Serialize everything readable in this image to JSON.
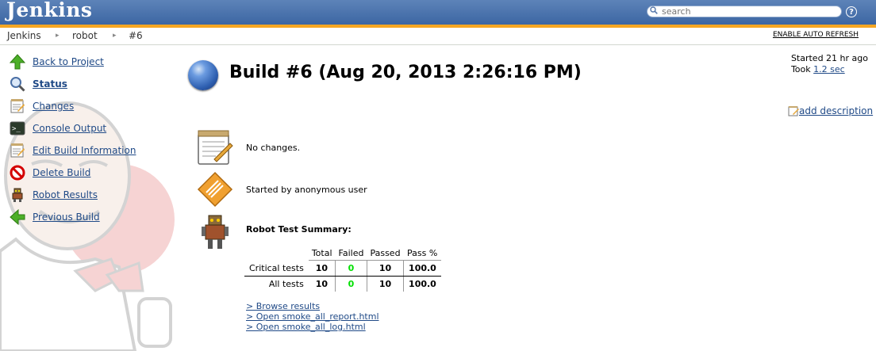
{
  "header": {
    "logo": "Jenkins",
    "search_placeholder": "search",
    "help_label": "?"
  },
  "breadcrumb": {
    "items": [
      "Jenkins",
      "robot",
      "#6"
    ],
    "separator": "▸",
    "auto_refresh": "ENABLE AUTO REFRESH"
  },
  "sidebar": {
    "items": [
      {
        "label": "Back to Project",
        "icon": "up-arrow-icon"
      },
      {
        "label": "Status",
        "icon": "magnifier-icon"
      },
      {
        "label": "Changes",
        "icon": "notepad-icon"
      },
      {
        "label": "Console Output",
        "icon": "terminal-icon"
      },
      {
        "label": "Edit Build Information",
        "icon": "notepad-icon"
      },
      {
        "label": "Delete Build",
        "icon": "no-entry-icon"
      },
      {
        "label": "Robot Results",
        "icon": "robot-icon"
      },
      {
        "label": "Previous Build",
        "icon": "left-arrow-icon"
      }
    ]
  },
  "build": {
    "title": "Build #6 (Aug 20, 2013 2:26:16 PM)",
    "started": "Started 21 hr ago",
    "took_prefix": "Took",
    "took_value": "1.2 sec",
    "add_description": "add description"
  },
  "rows": {
    "changes": "No changes.",
    "cause": "Started by anonymous user",
    "robot_summary_title": "Robot Test Summary:"
  },
  "robot_table": {
    "headers": [
      "Total",
      "Failed",
      "Passed",
      "Pass %"
    ],
    "rows": [
      {
        "label": "Critical tests",
        "total": "10",
        "failed": "0",
        "passed": "10",
        "pass_pct": "100.0"
      },
      {
        "label": "All tests",
        "total": "10",
        "failed": "0",
        "passed": "10",
        "pass_pct": "100.0"
      }
    ]
  },
  "links": [
    "> Browse results",
    "> Open smoke_all_report.html",
    "> Open smoke_all_log.html"
  ],
  "colors": {
    "header_blue": "#3c66a3",
    "header_orange": "#f5a623",
    "link_blue": "#204A87",
    "pass_green": "#00e000",
    "ball_blue": "#2e5fb0"
  }
}
